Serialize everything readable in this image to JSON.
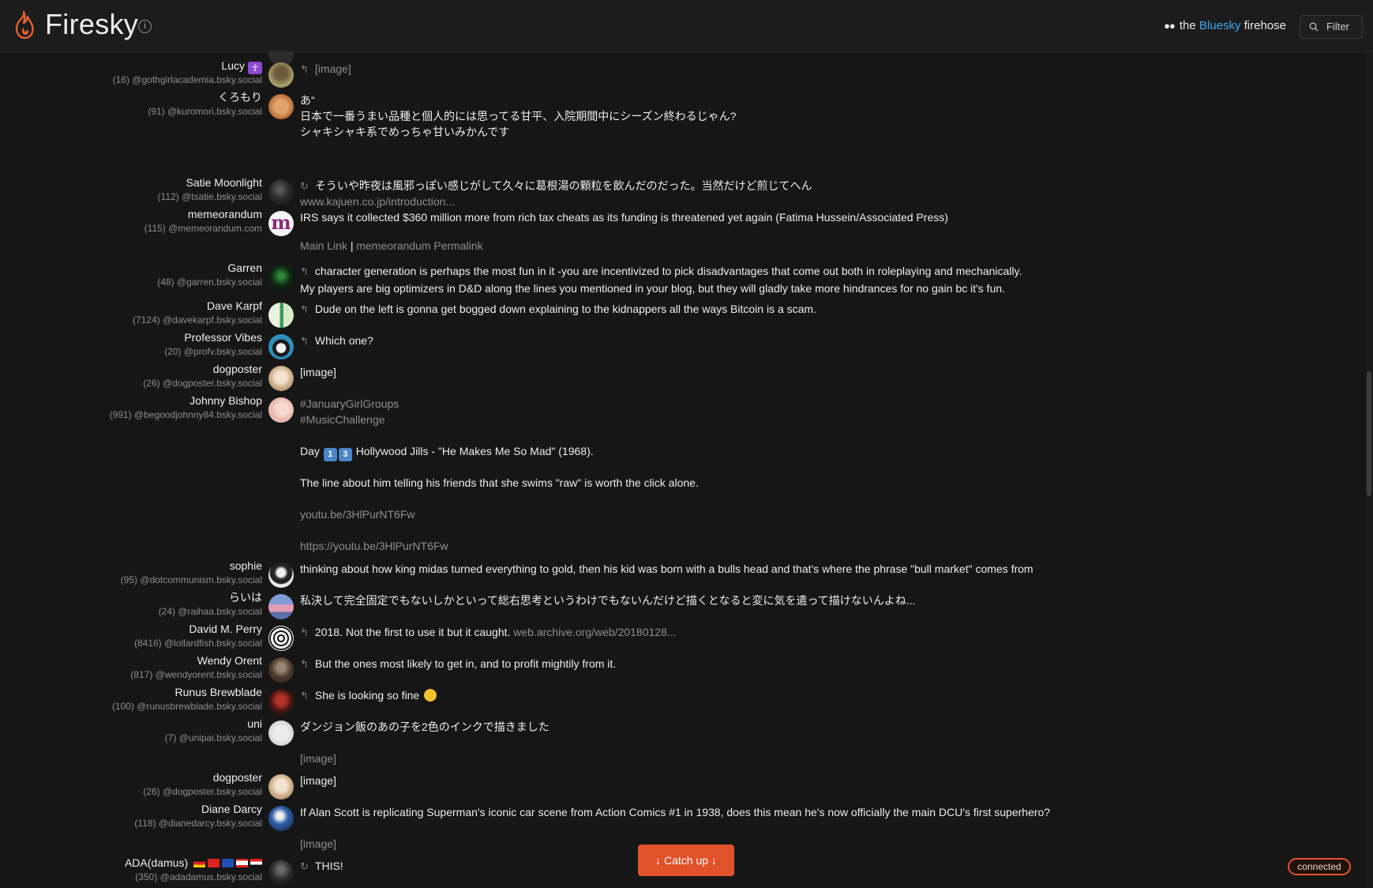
{
  "app": {
    "title": "Firesky",
    "tagline_prefix": "the",
    "tagline_highlight": "Bluesky",
    "tagline_suffix": "firehose",
    "filter_label": "Filter",
    "catch_up_label": "↓ Catch up ↓",
    "status_label": "connected",
    "accent_color": "#e2522a",
    "link_color": "#39a7ef"
  },
  "posts": [
    {
      "name": "Lucy",
      "name_badge": "☥",
      "handle": "(16) @gothgirlacademia.bsky.social",
      "reply": "↰",
      "text": "",
      "muted": "[image]"
    },
    {
      "name": "くろもり",
      "handle": "(91) @kuromori.bsky.social",
      "text": "あ”\n日本で一番うまい品種と個人的には思ってる甘平、入院期間中にシーズン終わるじゃん?\nシャキシャキ系でめっちゃ甘いみかんです",
      "link": "www.kajuen.co.jp/introduction..."
    },
    {
      "name": "Satie Moonlight",
      "handle": "(112) @tsatie.bsky.social",
      "reply": "↻",
      "text": "そういや昨夜は風邪っぽい感じがして久々に葛根湯の顆粒を飲んだのだった。当然だけど煎じてへん"
    },
    {
      "name": "memeorandum",
      "handle": "(115) @memeorandum.com",
      "text": "IRS says it collected $360 million more from rich tax cheats as its funding is threatened yet again (Fatima Hussein/Associated Press)",
      "link_a": "Main Link",
      "link_sep": "|",
      "link_b": "memeorandum Permalink"
    },
    {
      "name": "Garren",
      "handle": "(48) @garren.bsky.social",
      "reply": "↰",
      "text": "character generation is perhaps the most fun in it -you are incentivized to pick disadvantages that come out both in roleplaying and mechanically.\nMy players are big optimizers in D&D along the lines you mentioned in your blog, but they will gladly take more hindrances for no gain bc it's fun."
    },
    {
      "name": "Dave Karpf",
      "handle": "(7124) @davekarpf.bsky.social",
      "reply": "↰",
      "text": "Dude on the left is gonna get bogged down explaining to the kidnappers all the ways Bitcoin is a scam."
    },
    {
      "name": "Professor Vibes",
      "handle": "(20) @profv.bsky.social",
      "reply": "↰",
      "text": "Which one?"
    },
    {
      "name": "dogposter",
      "handle": "(26) @dogposter.bsky.social",
      "muted": "[image]"
    },
    {
      "name": "Johnny Bishop",
      "handle": "(991) @begoodjohnny84.bsky.social",
      "hashtags": [
        "#JanuaryGirlGroups",
        "#MusicChallenge"
      ],
      "day_prefix": "Day",
      "day_digits": [
        "1",
        "3"
      ],
      "day_text": "Hollywood Jills - \"He Makes Me So Mad\" (1968).",
      "text2": "The line about him telling his friends that she swims \"raw\" is worth the click alone.",
      "link1": "youtu.be/3HlPurNT6Fw",
      "link2": "https://youtu.be/3HlPurNT6Fw"
    },
    {
      "name": "sophie",
      "handle": "(95) @dotcommunism.bsky.social",
      "text": "thinking about how king midas turned everything to gold, then his kid was born with a bulls head and that's where the phrase \"bull market\" comes from"
    },
    {
      "name": "らいは",
      "handle": "(24) @raihaa.bsky.social",
      "text": "私決して完全固定でもないしかといって総右思考というわけでもないんだけど描くとなると変に気を遣って描けないんよね..."
    },
    {
      "name": "David M. Perry",
      "handle": "(8416) @lollardfish.bsky.social",
      "reply": "↰",
      "text": "2018. Not the first to use it but it caught.",
      "inline_link": "web.archive.org/web/20180128..."
    },
    {
      "name": "Wendy Orent",
      "handle": "(817) @wendyorent.bsky.social",
      "reply": "↰",
      "text": "But the ones most likely to get in, and to profit mightily from it."
    },
    {
      "name": "Runus Brewblade",
      "handle": "(100) @runusbrewblade.bsky.social",
      "reply": "↰",
      "text": "She is looking so fine"
    },
    {
      "name": "uni",
      "handle": "(7) @unipai.bsky.social",
      "text": "ダンジョン飯のあの子を2色のインクで描きました",
      "muted": "[image]"
    },
    {
      "name": "dogposter",
      "handle": "(26) @dogposter.bsky.social",
      "muted": "[image]"
    },
    {
      "name": "Diane Darcy",
      "handle": "(118) @dianedarcy.bsky.social",
      "text": "If Alan Scott is replicating Superman's iconic car scene from Action Comics #1 in 1938, does this mean he's now officially the main DCU's first superhero?",
      "muted": "[image]"
    },
    {
      "name": "ADA(damus)",
      "handle": "(350) @adadamus.bsky.social",
      "reply": "↻",
      "text": "THIS!"
    }
  ]
}
